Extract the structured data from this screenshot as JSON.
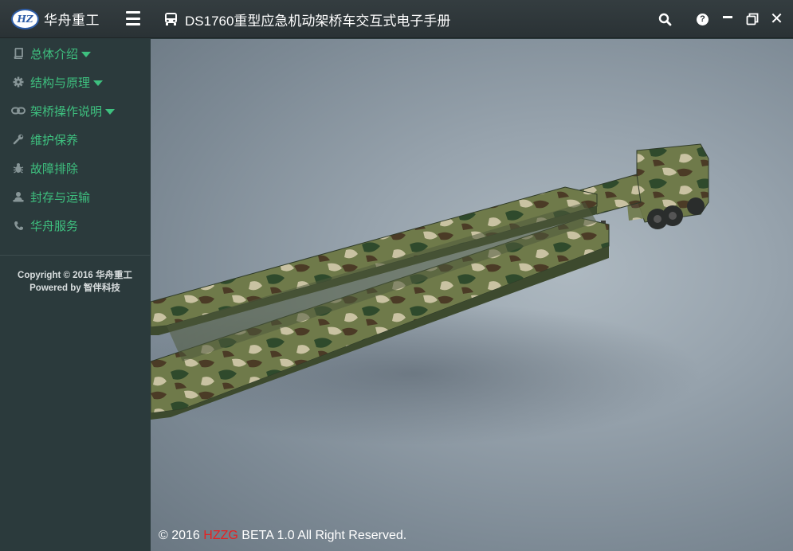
{
  "brand": {
    "name": "华舟重工",
    "logo_text": "HZ"
  },
  "header": {
    "title": "DS1760重型应急机动架桥车交互式电子手册"
  },
  "sidebar": {
    "items": [
      {
        "label": "总体介绍",
        "icon": "book-icon",
        "has_caret": true
      },
      {
        "label": "结构与原理",
        "icon": "gear-icon",
        "has_caret": true
      },
      {
        "label": "架桥操作说明",
        "icon": "link-icon",
        "has_caret": true
      },
      {
        "label": "维护保养",
        "icon": "wrench-icon",
        "has_caret": false
      },
      {
        "label": "故障排除",
        "icon": "bug-icon",
        "has_caret": false
      },
      {
        "label": "封存与运输",
        "icon": "archive-icon",
        "has_caret": false
      },
      {
        "label": "华舟服务",
        "icon": "phone-icon",
        "has_caret": false
      }
    ],
    "copyright_line1": "Copyright © 2016 华舟重工",
    "copyright_line2": "Powered by 智伴科技"
  },
  "footer": {
    "prefix": "© 2016 ",
    "highlight": "HZZG",
    "suffix": " BETA 1.0 All Right Reserved."
  },
  "colors": {
    "accent": "#3ec07f",
    "sidebar_bg": "#2b3a3c",
    "highlight_red": "#e82020"
  }
}
